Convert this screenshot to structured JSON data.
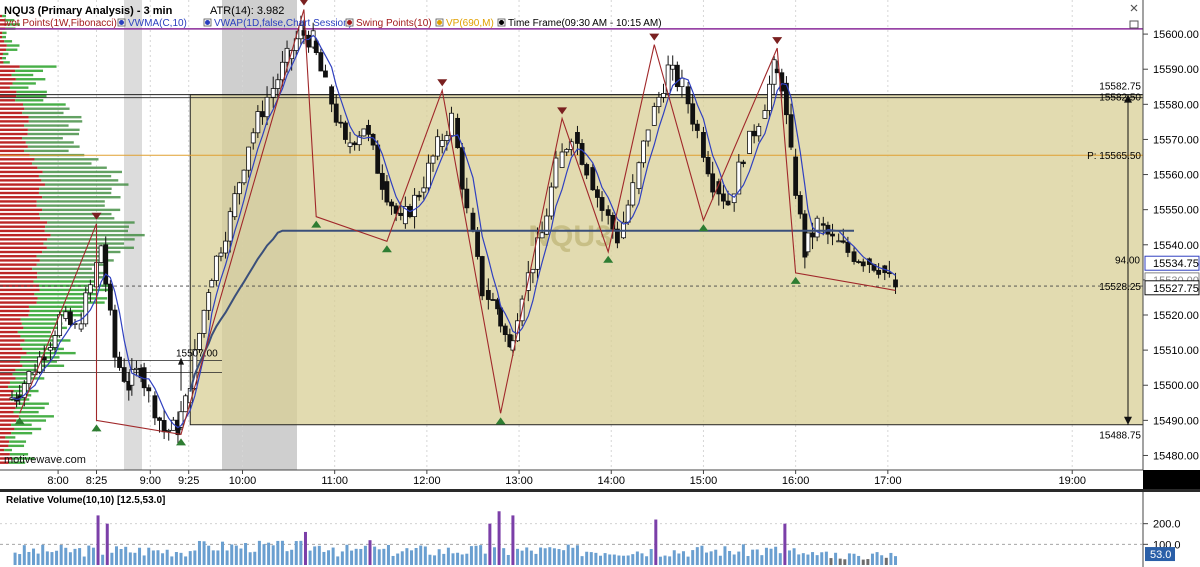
{
  "header": {
    "symbol_title": "NQU3 (Primary Analysis) - 3 min",
    "atr": "ATR(14): 3.982",
    "indicators": [
      {
        "label": "ivot Points(1W,Fibonacci)",
        "color": "#a11a1a",
        "icon": "pivot-icon"
      },
      {
        "label": "VWMA(C,10)",
        "color": "#2a3fbf",
        "icon": "vwma-icon"
      },
      {
        "label": "VWAP(1D,false,Chart Session)",
        "color": "#2a3fbf",
        "icon": "vwap-icon"
      },
      {
        "label": "Swing Points(10)",
        "color": "#a11a1a",
        "icon": "swing-icon"
      },
      {
        "label": "VP(690,M)",
        "color": "#e0a000",
        "icon": "vp-icon"
      },
      {
        "label": "Time Frame(09:30 AM - 10:15 AM)",
        "color": "#000000",
        "icon": "clock-icon"
      }
    ],
    "window_icons": [
      "close-icon",
      "maximize-icon"
    ]
  },
  "watermark": "NQU3",
  "branding": "motivewave.com",
  "price_axis": {
    "ticks": [
      "15600.00",
      "15590.00",
      "15580.00",
      "15570.00",
      "15560.00",
      "15550.00",
      "15540.00",
      "15530.00",
      "15520.00",
      "15510.00",
      "15500.00",
      "15490.00",
      "15480.00"
    ],
    "current_price": "15527.75",
    "vwma_price": "15534.75",
    "hidden_price": "15530.00"
  },
  "time_axis": {
    "ticks": [
      "8:00",
      "8:25",
      "9:00",
      "9:25",
      "10:00",
      "11:00",
      "12:00",
      "13:00",
      "14:00",
      "15:00",
      "16:00",
      "17:00",
      "19:00"
    ]
  },
  "annotations": {
    "range_high": "15582.75",
    "range_high_overlap": "15582.50",
    "pivot": "P: 15565.50",
    "range_low": "15488.75",
    "range_size": "94.00",
    "measure_level": "15528.25",
    "opening_level": "15507.00"
  },
  "volume_panel": {
    "title": "Relative Volume(10,10) [12.5,53.0]",
    "ticks": [
      "200.0",
      "100.0"
    ],
    "current": "53.0"
  },
  "colors": {
    "range_fill": "#d8cf95",
    "pivot_line": "#e0a030",
    "upper_line": "#8a2a9a",
    "vwap": "#3a4f7a",
    "vwma": "#3040c0",
    "zigzag": "#a0282a",
    "swing_up": "#2e7d32",
    "swing_down": "#7a2020",
    "volume_bar": "#6a9fd0",
    "volume_high": "#7b3fa8",
    "volume_low": "#6d6d6d"
  },
  "chart_data": {
    "type": "candlestick",
    "timeframe": "3 min",
    "y_range": [
      15477,
      15608
    ],
    "x_ticks": [
      "8:00",
      "8:25",
      "9:00",
      "9:25",
      "10:00",
      "11:00",
      "12:00",
      "13:00",
      "14:00",
      "15:00",
      "16:00",
      "17:00",
      "19:00"
    ],
    "levels": {
      "range_high": 15582.75,
      "pivot": 15565.5,
      "range_low": 15488.75,
      "upper_purple": 15601.5,
      "measure_level": 15528.25,
      "opening_level": 15507.0
    },
    "anchors_ohlc": [
      [
        "7:30",
        15496,
        15500,
        15492,
        15497
      ],
      [
        "7:35",
        15497,
        15505,
        15495,
        15503
      ],
      [
        "7:45",
        15503,
        15512,
        15500,
        15510
      ],
      [
        "7:55",
        15510,
        15521,
        15508,
        15519
      ],
      [
        "8:05",
        15519,
        15524,
        15512,
        15516
      ],
      [
        "8:15",
        15516,
        15530,
        15514,
        15528
      ],
      [
        "8:25",
        15528,
        15546,
        15525,
        15540
      ],
      [
        "8:31",
        15540,
        15542,
        15505,
        15508
      ],
      [
        "8:40",
        15508,
        15512,
        15497,
        15500
      ],
      [
        "8:48",
        15500,
        15512,
        15496,
        15505
      ],
      [
        "8:56",
        15505,
        15510,
        15494,
        15497
      ],
      [
        "9:03",
        15497,
        15502,
        15484,
        15487
      ],
      [
        "9:12",
        15487,
        15492,
        15479,
        15488
      ],
      [
        "9:20",
        15488,
        15500,
        15486,
        15495
      ],
      [
        "9:26",
        15495,
        15532,
        15494,
        15528
      ],
      [
        "9:40",
        15528,
        15552,
        15526,
        15548
      ],
      [
        "9:55",
        15548,
        15572,
        15546,
        15569
      ],
      [
        "10:07",
        15569,
        15585,
        15566,
        15582
      ],
      [
        "10:20",
        15582,
        15596,
        15580,
        15593
      ],
      [
        "10:32",
        15593,
        15603,
        15590,
        15601
      ],
      [
        "10:40",
        15601,
        15607,
        15595,
        15598
      ],
      [
        "10:48",
        15598,
        15600,
        15582,
        15585
      ],
      [
        "10:58",
        15585,
        15588,
        15563,
        15568
      ],
      [
        "11:10",
        15568,
        15578,
        15562,
        15574
      ],
      [
        "11:22",
        15574,
        15576,
        15554,
        15558
      ],
      [
        "11:34",
        15558,
        15562,
        15541,
        15546
      ],
      [
        "11:46",
        15546,
        15558,
        15544,
        15555
      ],
      [
        "11:58",
        15555,
        15572,
        15552,
        15568
      ],
      [
        "12:10",
        15568,
        15584,
        15565,
        15576
      ],
      [
        "12:20",
        15576,
        15579,
        15545,
        15549
      ],
      [
        "12:30",
        15549,
        15552,
        15520,
        15527
      ],
      [
        "12:40",
        15527,
        15532,
        15514,
        15522
      ],
      [
        "12:48",
        15522,
        15524,
        15492,
        15510
      ],
      [
        "12:56",
        15510,
        15530,
        15505,
        15527
      ],
      [
        "13:06",
        15527,
        15546,
        15524,
        15543
      ],
      [
        "13:18",
        15543,
        15565,
        15540,
        15562
      ],
      [
        "13:28",
        15562,
        15576,
        15558,
        15572
      ],
      [
        "13:38",
        15572,
        15575,
        15557,
        15562
      ],
      [
        "13:48",
        15562,
        15565,
        15546,
        15550
      ],
      [
        "13:58",
        15550,
        15552,
        15538,
        15542
      ],
      [
        "14:08",
        15542,
        15560,
        15540,
        15556
      ],
      [
        "14:18",
        15556,
        15578,
        15552,
        15574
      ],
      [
        "14:28",
        15574,
        15592,
        15570,
        15590
      ],
      [
        "14:40",
        15590,
        15597,
        15580,
        15585
      ],
      [
        "14:50",
        15585,
        15588,
        15568,
        15572
      ],
      [
        "15:00",
        15572,
        15575,
        15550,
        15558
      ],
      [
        "15:10",
        15558,
        15565,
        15547,
        15552
      ],
      [
        "15:20",
        15552,
        15570,
        15550,
        15566
      ],
      [
        "15:30",
        15566,
        15580,
        15562,
        15576
      ],
      [
        "15:40",
        15576,
        15592,
        15572,
        15590
      ],
      [
        "15:48",
        15590,
        15596,
        15582,
        15586
      ],
      [
        "15:54",
        15586,
        15588,
        15560,
        15565
      ],
      [
        "16:00",
        15565,
        15568,
        15532,
        15538
      ],
      [
        "16:08",
        15538,
        15550,
        15535,
        15546
      ],
      [
        "16:18",
        15546,
        15550,
        15538,
        15541
      ],
      [
        "16:28",
        15541,
        15545,
        15535,
        15538
      ],
      [
        "16:38",
        15538,
        15542,
        15533,
        15536
      ],
      [
        "16:48",
        15536,
        15540,
        15531,
        15534
      ],
      [
        "16:58",
        15534,
        15536,
        15527,
        15530
      ],
      [
        "17:05",
        15530,
        15532,
        15526,
        15528
      ]
    ],
    "swing_highs": [
      {
        "time": "8:25",
        "price": 15546
      },
      {
        "time": "10:40",
        "price": 15607
      },
      {
        "time": "12:10",
        "price": 15584
      },
      {
        "time": "13:28",
        "price": 15576
      },
      {
        "time": "14:28",
        "price": 15597
      },
      {
        "time": "15:48",
        "price": 15596
      }
    ],
    "swing_lows": [
      {
        "time": "7:35",
        "price": 15492
      },
      {
        "time": "8:25",
        "price": 15490
      },
      {
        "time": "9:20",
        "price": 15486
      },
      {
        "time": "10:48",
        "price": 15548
      },
      {
        "time": "11:34",
        "price": 15541
      },
      {
        "time": "12:48",
        "price": 15492
      },
      {
        "time": "13:58",
        "price": 15538
      },
      {
        "time": "15:00",
        "price": 15547
      },
      {
        "time": "16:00",
        "price": 15532
      }
    ],
    "relative_volume": {
      "y_range": [
        0,
        300
      ],
      "current": 53.0
    }
  }
}
